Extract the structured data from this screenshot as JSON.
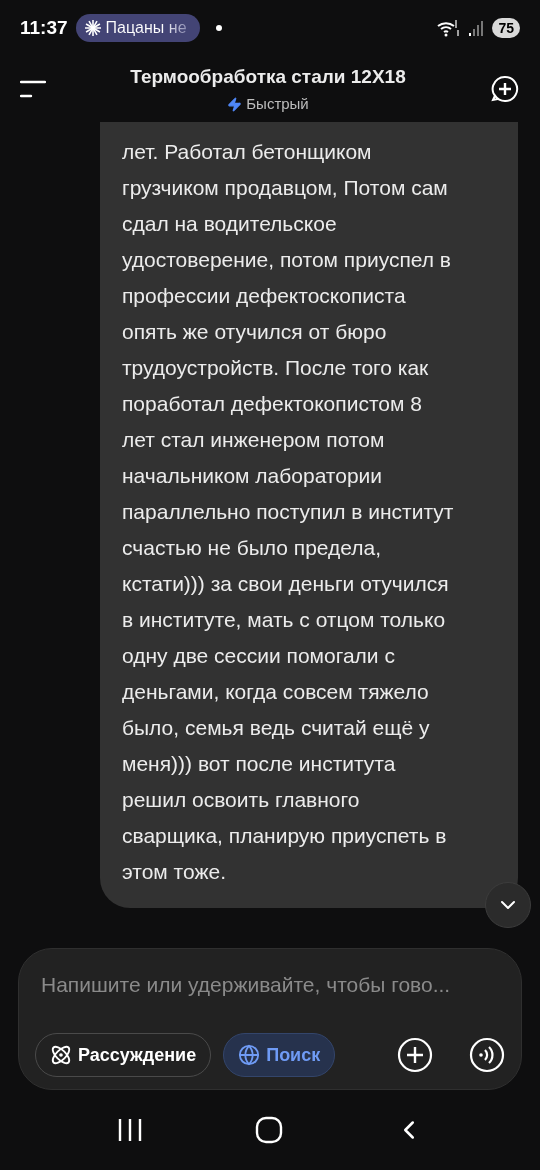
{
  "status_bar": {
    "time": "11:37",
    "notification": "Пацаны не",
    "battery": "75"
  },
  "header": {
    "title": "Термообработка стали 12Х18",
    "mode": "Быстрый"
  },
  "message": {
    "text": "лет. Работал бетонщиком\nгрузчиком продавцом, Потом сам\nсдал на водительское\nудостоверение, потом приуспел в\nпрофессии дефектоскописта\nопять же отучился от бюро\nтрудоустройств. После того как\nпоработал дефектокопистом 8\nлет стал инженером потом\nначальником лаборатории\nпараллельно поступил в институт\nсчастью не было предела,\nкстати))) за свои деньги отучился\nв институте,  мать с отцом только\nодну две сессии помогали с\nденьгами, когда совсем тяжело\nбыло,  семья ведь считай ещё у\nменя))) вот после института\nрешил освоить главного\nсварщика, планирую приуспеть в\nэтом тоже."
  },
  "composer": {
    "placeholder": "Напишите или удерживайте, чтобы гово...",
    "chips": [
      {
        "label": "Рассуждение",
        "kind": "reasoning",
        "selected": false
      },
      {
        "label": "Поиск",
        "kind": "search",
        "selected": true
      }
    ]
  }
}
